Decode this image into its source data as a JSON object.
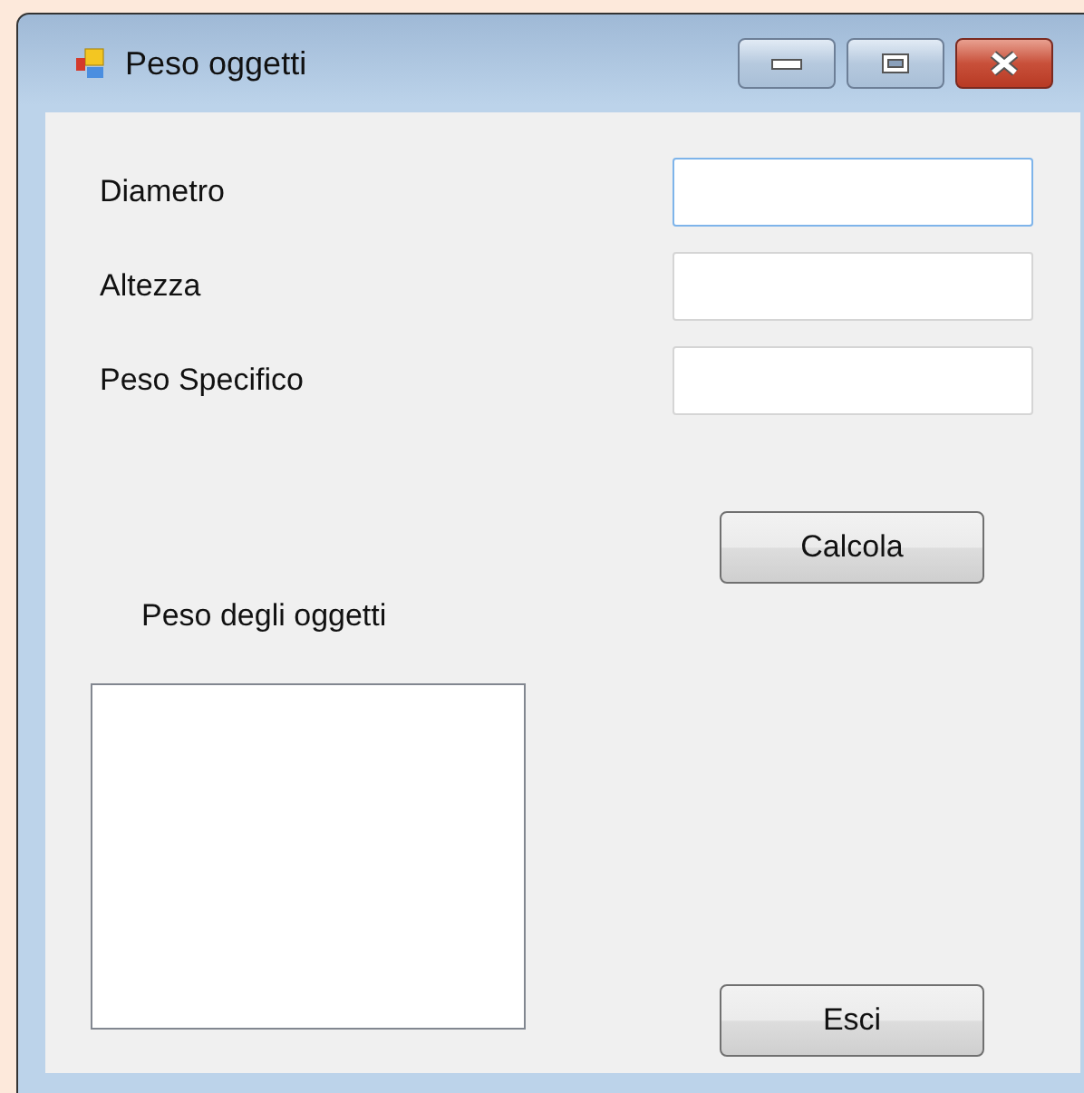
{
  "window": {
    "title": "Peso oggetti"
  },
  "fields": [
    {
      "label": "Diametro",
      "focused": true
    },
    {
      "label": "Altezza",
      "focused": false
    },
    {
      "label": "Peso Specifico",
      "focused": false
    }
  ],
  "calculate_button": "Calcola",
  "result": {
    "label": "Peso degli oggetti"
  },
  "exit_button": "Esci"
}
